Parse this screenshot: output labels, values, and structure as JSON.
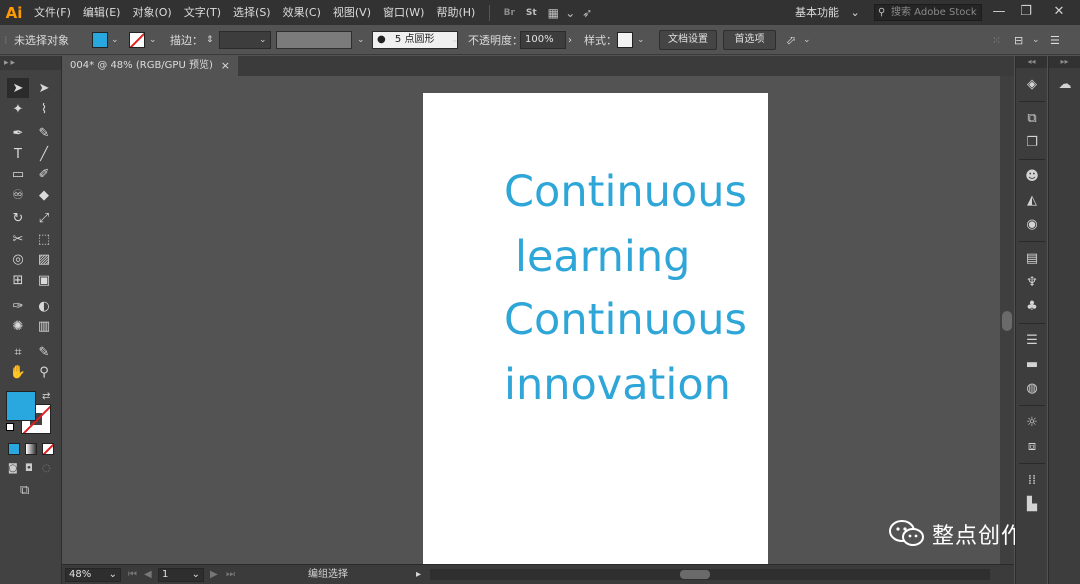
{
  "app": {
    "logo": "Ai",
    "accent": "#ff9a00"
  },
  "menu": [
    "文件(F)",
    "编辑(E)",
    "对象(O)",
    "文字(T)",
    "选择(S)",
    "效果(C)",
    "视图(V)",
    "窗口(W)",
    "帮助(H)"
  ],
  "menubar_icons": {
    "br": "Br",
    "st": "St",
    "layout": "▦",
    "layout_arrow": "⌄",
    "rocket": "➶"
  },
  "workspace": {
    "label": "基本功能",
    "arrow": "⌄"
  },
  "stock_search": {
    "placeholder": "搜索 Adobe Stock"
  },
  "window_controls": {
    "minimize": "—",
    "restore": "❐",
    "close": "✕"
  },
  "control_bar": {
    "selection": "未选择对象",
    "fill_color": "#29a8e0",
    "stroke_label": "描边：",
    "stroke_weight": "",
    "brush_label": "5 点圆形",
    "opacity_label": "不透明度：",
    "opacity_value": "100%",
    "style_label": "样式：",
    "doc_setup": "文档设置",
    "preferences": "首选项"
  },
  "tool_panel": {
    "header": "▸▸"
  },
  "document_tab": {
    "title": "004* @ 48% (RGB/GPU 预览)",
    "close": "×"
  },
  "artboard": {
    "lines": [
      "Continuous",
      "learning",
      "Continuous",
      "innovation"
    ],
    "text_color": "#2fa6d8",
    "background": "#ffffff"
  },
  "status_bar": {
    "zoom": "48%",
    "page": "1",
    "mode": "编组选择"
  },
  "watermark": {
    "text": "整点创作"
  },
  "fill": {
    "color": "#29a8e0"
  },
  "tools": [
    {
      "name": "selection-tool",
      "glyph": "➤"
    },
    {
      "name": "direct-selection-tool",
      "glyph": "➤"
    },
    {
      "name": "magic-wand-tool",
      "glyph": "✦"
    },
    {
      "name": "lasso-tool",
      "glyph": "⌇"
    },
    {
      "name": "pen-tool",
      "glyph": "✒"
    },
    {
      "name": "curvature-tool",
      "glyph": "✎"
    },
    {
      "name": "type-tool",
      "glyph": "T"
    },
    {
      "name": "line-tool",
      "glyph": "╱"
    },
    {
      "name": "rectangle-tool",
      "glyph": "▭"
    },
    {
      "name": "paintbrush-tool",
      "glyph": "✐"
    },
    {
      "name": "shaper-tool",
      "glyph": "♾"
    },
    {
      "name": "eraser-tool",
      "glyph": "◆"
    },
    {
      "name": "rotate-tool",
      "glyph": "↻"
    },
    {
      "name": "scale-tool",
      "glyph": "⤢"
    },
    {
      "name": "width-tool",
      "glyph": "✂"
    },
    {
      "name": "free-transform-tool",
      "glyph": "⬚"
    },
    {
      "name": "shape-builder-tool",
      "glyph": "◎"
    },
    {
      "name": "perspective-grid-tool",
      "glyph": "▨"
    },
    {
      "name": "mesh-tool",
      "glyph": "⊞"
    },
    {
      "name": "gradient-tool",
      "glyph": "▣"
    },
    {
      "name": "eyedropper-tool",
      "glyph": "✑"
    },
    {
      "name": "blend-tool",
      "glyph": "◐"
    },
    {
      "name": "symbol-sprayer-tool",
      "glyph": "✺"
    },
    {
      "name": "column-graph-tool",
      "glyph": "▥"
    },
    {
      "name": "artboard-tool",
      "glyph": "⌗"
    },
    {
      "name": "slice-tool",
      "glyph": "✎"
    },
    {
      "name": "hand-tool",
      "glyph": "✋"
    },
    {
      "name": "zoom-tool",
      "glyph": "⚲"
    }
  ],
  "dock1": [
    "◈",
    "⧉",
    "❐",
    "☻",
    "◭",
    "◉",
    "▤",
    "♆",
    "♣",
    "☰",
    "▬",
    "◍",
    "☼",
    "⧈",
    "⁞⁞",
    "▙"
  ],
  "dock2": [
    "☁"
  ]
}
